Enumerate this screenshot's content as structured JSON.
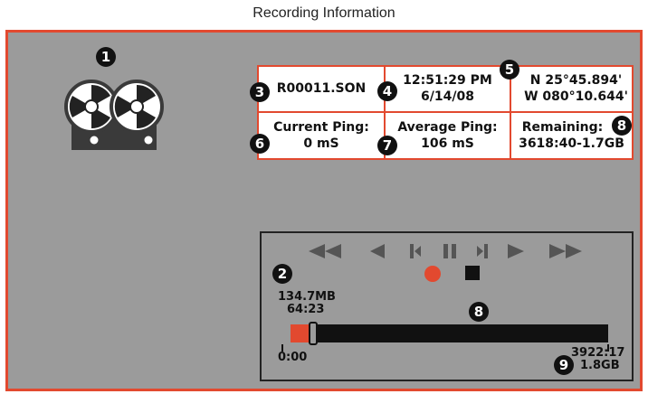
{
  "caption": "Recording Information",
  "info": {
    "filename": "R00011.SON",
    "time": "12:51:29 PM",
    "date": "6/14/08",
    "latitude": "N 25°45.894'",
    "longitude": "W 080°10.644'",
    "current_ping_label": "Current Ping:",
    "current_ping_value": "0 mS",
    "average_ping_label": "Average Ping:",
    "average_ping_value": "106 mS",
    "remaining_label": "Remaining:",
    "remaining_value": "3618:40-1.7GB"
  },
  "playback": {
    "position_size": "134.7MB",
    "position_time": "64:23",
    "start_time": "0:00",
    "end_time": "3922:17",
    "end_size": "1.8GB",
    "progress_fraction": 0.064,
    "buttons": [
      "rewind",
      "step-back",
      "frame-back",
      "pause",
      "frame-forward",
      "play",
      "fast-forward",
      "record",
      "stop"
    ]
  },
  "callouts": [
    "1",
    "2",
    "3",
    "4",
    "5",
    "6",
    "7",
    "8",
    "8",
    "9"
  ],
  "colors": {
    "accent": "#e2492f",
    "screen_bg": "#9b9b9b",
    "dark": "#111111"
  }
}
